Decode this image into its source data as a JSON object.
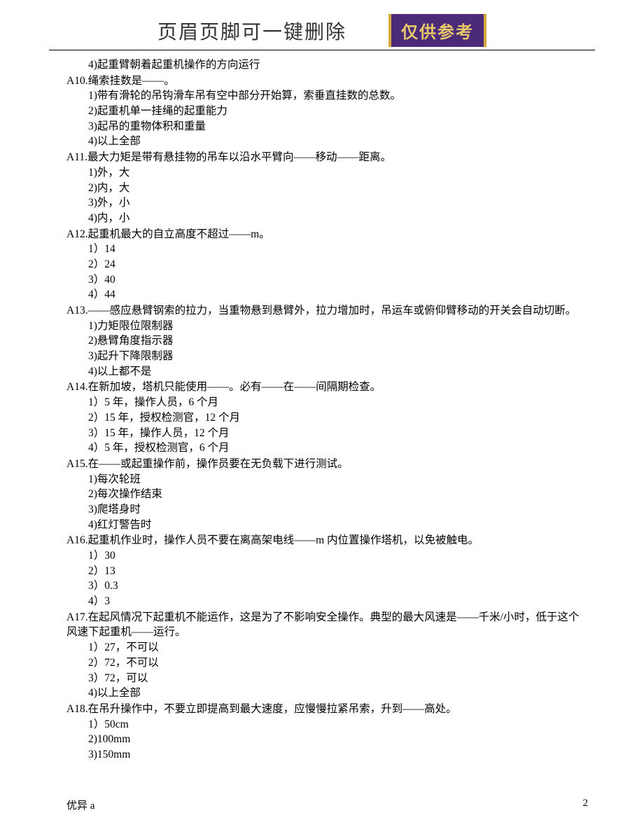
{
  "header": {
    "title": "页眉页脚可一键删除",
    "badge": "仅供参考"
  },
  "orphan_option": "4)起重臂朝着起重机操作的方向运行",
  "questions": [
    {
      "stem": "A10.绳索挂数是——。",
      "options": [
        "1)带有滑轮的吊钩滑车吊有空中部分开始算，索垂直挂数的总数。",
        "2)起重机单一挂绳的起重能力",
        "3)起吊的重物体积和重量",
        "4)以上全部"
      ]
    },
    {
      "stem": "A11.最大力矩是带有悬挂物的吊车以沿水平臂向——移动——距离。",
      "options": [
        "1)外，大",
        "2)内，大",
        "3)外，小",
        "4)内，小"
      ]
    },
    {
      "stem": "A12.起重机最大的自立高度不超过——m。",
      "options": [
        "1）14",
        "2）24",
        "3）40",
        "4）44"
      ]
    },
    {
      "stem": "A13.——感应悬臂钢索的拉力，当重物悬到悬臂外，拉力增加时，吊运车或俯仰臂移动的开关会自动切断。",
      "options": [
        "1)力矩限位限制器",
        "2)悬臂角度指示器",
        "3)起升下降限制器",
        "4)以上都不是"
      ]
    },
    {
      "stem": "A14.在新加坡，塔机只能使用——。必有——在——间隔期检查。",
      "options": [
        "1）5 年，操作人员，6 个月",
        "2）15 年，授权检测官，12 个月",
        "3）15 年，操作人员，12 个月",
        "4）5 年，授权检测官，6 个月"
      ]
    },
    {
      "stem": "A15.在——或起重操作前，操作员要在无负载下进行测试。",
      "options": [
        "1)每次轮班",
        "2)每次操作结束",
        "3)爬塔身时",
        "4)红灯警告时"
      ]
    },
    {
      "stem": "A16.起重机作业时，操作人员不要在离高架电线——m 内位置操作塔机，以免被触电。",
      "options": [
        "1）30",
        "2）13",
        "3）0.3",
        "4）3"
      ]
    },
    {
      "stem": "A17.在起风情况下起重机不能运作，这是为了不影响安全操作。典型的最大风速是——千米/小时，低于这个风速下起重机——运行。",
      "options": [
        "1）27，不可以",
        "2）72，不可以",
        "3）72，可以",
        "4)以上全部"
      ]
    },
    {
      "stem": "A18.在吊升操作中，不要立即提高到最大速度，应慢慢拉紧吊索，升到——高处。",
      "options": [
        "1）50cm",
        "2)100mm",
        "3)150mm"
      ]
    }
  ],
  "footer": {
    "left": "优异 a",
    "right": "2"
  }
}
